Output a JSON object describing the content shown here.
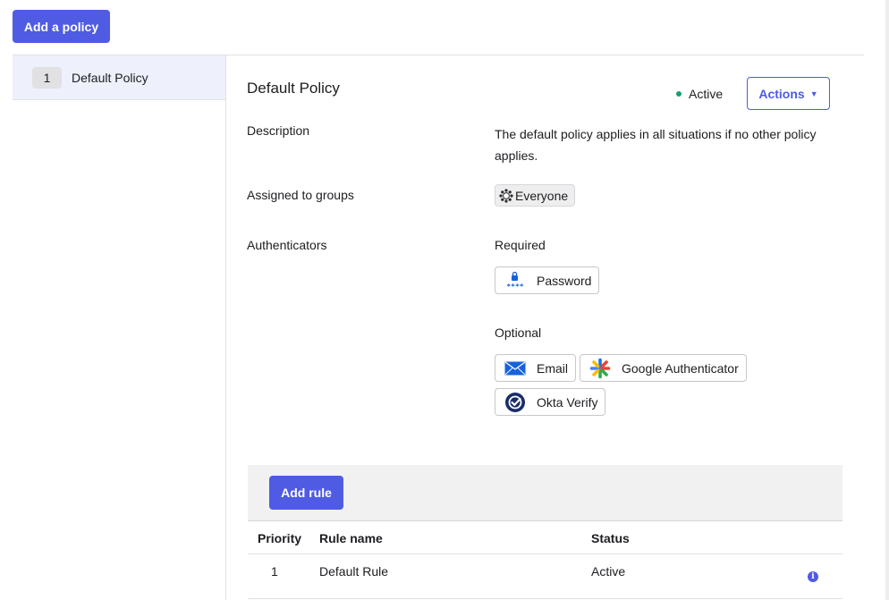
{
  "toolbar": {
    "add_policy_label": "Add a policy"
  },
  "sidebar": {
    "policies": [
      {
        "priority": "1",
        "name": "Default Policy"
      }
    ]
  },
  "policy": {
    "title": "Default Policy",
    "status": "Active",
    "actions_label": "Actions",
    "description_label": "Description",
    "description_value": "The default policy applies in all situations if no other policy applies.",
    "groups_label": "Assigned to groups",
    "groups": [
      {
        "name": "Everyone",
        "icon": "group-icon"
      }
    ],
    "authenticators_label": "Authenticators",
    "required_label": "Required",
    "required": [
      {
        "name": "Password",
        "icon": "password-icon"
      }
    ],
    "optional_label": "Optional",
    "optional": [
      {
        "name": "Email",
        "icon": "email-icon"
      },
      {
        "name": "Google Authenticator",
        "icon": "google-authenticator-icon"
      },
      {
        "name": "Okta Verify",
        "icon": "okta-verify-icon"
      }
    ]
  },
  "rules": {
    "add_rule_label": "Add rule",
    "columns": {
      "priority": "Priority",
      "name": "Rule name",
      "status": "Status"
    },
    "rows": [
      {
        "priority": "1",
        "name": "Default Rule",
        "status": "Active",
        "icon": "info-icon"
      }
    ]
  },
  "colors": {
    "accent": "#4f5be3",
    "status_active": "#1a9f6d",
    "selected_bg": "#eef0fb"
  }
}
